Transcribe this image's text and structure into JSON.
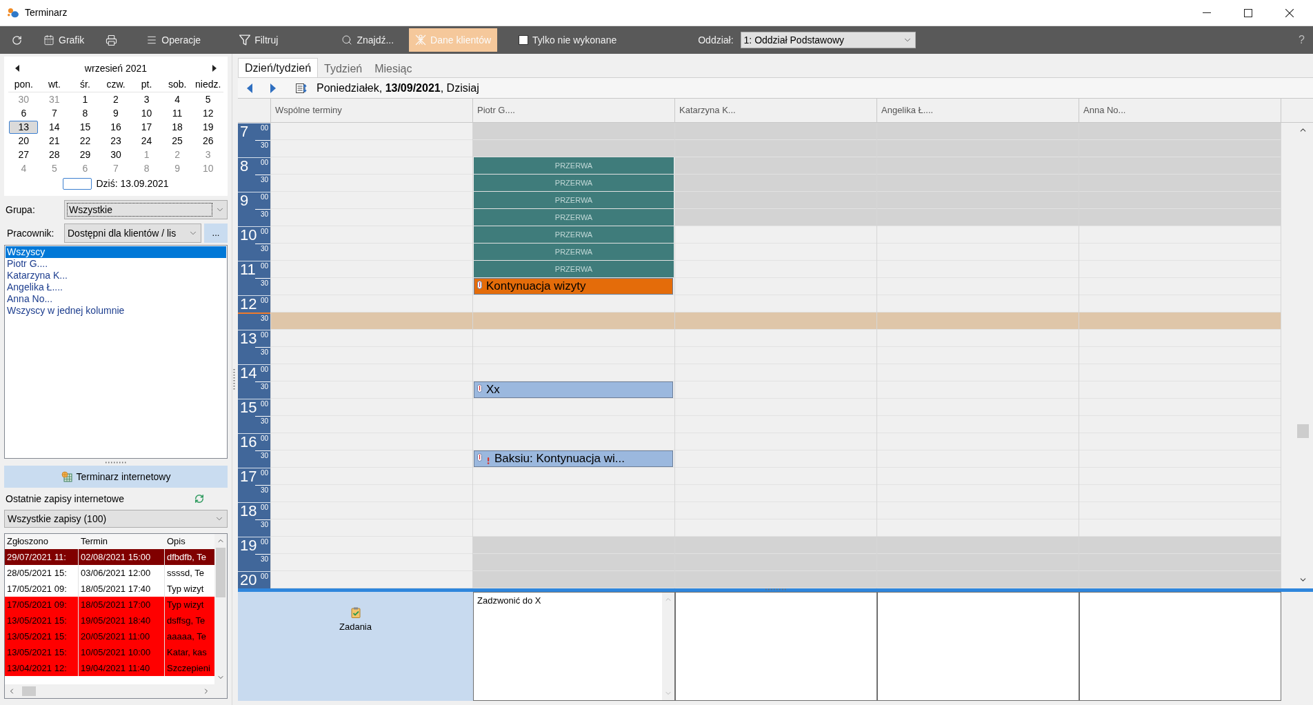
{
  "window": {
    "title": "Terminarz"
  },
  "toolbar": {
    "buttons": [
      {
        "label": "Grafik",
        "active": false
      },
      {
        "label": "Operacje",
        "active": false
      },
      {
        "label": "Filtruj",
        "active": false
      },
      {
        "label": "Znajdź...",
        "active": false
      },
      {
        "label": "Dane klientów",
        "active": true
      }
    ],
    "only_pending": {
      "label": "Tylko nie wykonane",
      "checked": false
    },
    "branch": {
      "label": "Oddział:",
      "value": "1: Oddział Podstawowy"
    },
    "help": "?"
  },
  "mini_calendar": {
    "month": "wrzesień 2021",
    "weekdays": [
      "pon.",
      "wt.",
      "śr.",
      "czw.",
      "pt.",
      "sob.",
      "niedz."
    ],
    "weeks": [
      [
        {
          "day": "30",
          "outside": true,
          "selected": false
        },
        {
          "day": "31",
          "outside": true,
          "selected": false
        },
        {
          "day": "1",
          "outside": false,
          "selected": false
        },
        {
          "day": "2",
          "outside": false,
          "selected": false
        },
        {
          "day": "3",
          "outside": false,
          "selected": false
        },
        {
          "day": "4",
          "outside": false,
          "selected": false
        },
        {
          "day": "5",
          "outside": false,
          "selected": false
        }
      ],
      [
        {
          "day": "6",
          "outside": false,
          "selected": false
        },
        {
          "day": "7",
          "outside": false,
          "selected": false
        },
        {
          "day": "8",
          "outside": false,
          "selected": false
        },
        {
          "day": "9",
          "outside": false,
          "selected": false
        },
        {
          "day": "10",
          "outside": false,
          "selected": false
        },
        {
          "day": "11",
          "outside": false,
          "selected": false
        },
        {
          "day": "12",
          "outside": false,
          "selected": false
        }
      ],
      [
        {
          "day": "13",
          "outside": false,
          "selected": true
        },
        {
          "day": "14",
          "outside": false,
          "selected": false
        },
        {
          "day": "15",
          "outside": false,
          "selected": false
        },
        {
          "day": "16",
          "outside": false,
          "selected": false
        },
        {
          "day": "17",
          "outside": false,
          "selected": false
        },
        {
          "day": "18",
          "outside": false,
          "selected": false
        },
        {
          "day": "19",
          "outside": false,
          "selected": false
        }
      ],
      [
        {
          "day": "20",
          "outside": false,
          "selected": false
        },
        {
          "day": "21",
          "outside": false,
          "selected": false
        },
        {
          "day": "22",
          "outside": false,
          "selected": false
        },
        {
          "day": "23",
          "outside": false,
          "selected": false
        },
        {
          "day": "24",
          "outside": false,
          "selected": false
        },
        {
          "day": "25",
          "outside": false,
          "selected": false
        },
        {
          "day": "26",
          "outside": false,
          "selected": false
        }
      ],
      [
        {
          "day": "27",
          "outside": false,
          "selected": false
        },
        {
          "day": "28",
          "outside": false,
          "selected": false
        },
        {
          "day": "29",
          "outside": false,
          "selected": false
        },
        {
          "day": "30",
          "outside": false,
          "selected": false
        },
        {
          "day": "1",
          "outside": true,
          "selected": false
        },
        {
          "day": "2",
          "outside": true,
          "selected": false
        },
        {
          "day": "3",
          "outside": true,
          "selected": false
        }
      ],
      [
        {
          "day": "4",
          "outside": true,
          "selected": false
        },
        {
          "day": "5",
          "outside": true,
          "selected": false
        },
        {
          "day": "6",
          "outside": true,
          "selected": false
        },
        {
          "day": "7",
          "outside": true,
          "selected": false
        },
        {
          "day": "8",
          "outside": true,
          "selected": false
        },
        {
          "day": "9",
          "outside": true,
          "selected": false
        },
        {
          "day": "10",
          "outside": true,
          "selected": false
        }
      ]
    ],
    "today": "Dziś: 13.09.2021"
  },
  "filters": {
    "group": {
      "label": "Grupa:",
      "value": "Wszystkie"
    },
    "employee": {
      "label": "Pracownik:",
      "value": "Dostępni dla klientów / lis",
      "more": "..."
    }
  },
  "employees": [
    {
      "name": "Wszyscy",
      "selected": true
    },
    {
      "name": "Piotr G....",
      "selected": false
    },
    {
      "name": "Katarzyna K...",
      "selected": false
    },
    {
      "name": "Angelika Ł....",
      "selected": false
    },
    {
      "name": "Anna No...",
      "selected": false
    },
    {
      "name": "Wszyscy w jednej kolumnie",
      "selected": false
    }
  ],
  "online": {
    "button": "Terminarz internetowy",
    "heading": "Ostatnie zapisy internetowe",
    "filter": "Wszystkie zapisy (100)",
    "columns": [
      "Zgłoszono",
      "Termin",
      "Opis"
    ],
    "rows": [
      {
        "cells": [
          "29/07/2021 11:",
          "02/08/2021 15:00",
          "dfbdfb, Te"
        ],
        "color": "#800000",
        "selected": true
      },
      {
        "cells": [
          "28/05/2021 15:",
          "03/06/2021 12:00",
          "ssssd, Te"
        ],
        "color": "#ffffff",
        "selected": false
      },
      {
        "cells": [
          "17/05/2021 09:",
          "18/05/2021 17:40",
          "Typ wizyt"
        ],
        "color": "#ffffff",
        "selected": false
      },
      {
        "cells": [
          "17/05/2021 09:",
          "18/05/2021 17:00",
          "Typ wizyt"
        ],
        "color": "#ff0000",
        "selected": false
      },
      {
        "cells": [
          "13/05/2021 15:",
          "19/05/2021 18:40",
          "dsffsg, Te"
        ],
        "color": "#ff0000",
        "selected": false
      },
      {
        "cells": [
          "13/05/2021 15:",
          "20/05/2021 11:00",
          "aaaaa, Te"
        ],
        "color": "#ff0000",
        "selected": false
      },
      {
        "cells": [
          "13/05/2021 15:",
          "10/05/2021 10:00",
          "Katar, kas"
        ],
        "color": "#ff0000",
        "selected": false
      },
      {
        "cells": [
          "13/04/2021 12:",
          "19/04/2021 11:40",
          "Szczepieni"
        ],
        "color": "#ff0000",
        "selected": false
      }
    ]
  },
  "calendar_view": {
    "tabs": [
      {
        "label": "Dzień/tydzień",
        "selected": true
      },
      {
        "label": "Tydzień",
        "selected": false
      },
      {
        "label": "Miesiąc",
        "selected": false
      }
    ],
    "date": "Poniedziałek, **13/09/2021**, Dzisiaj",
    "rows": [
      {
        "hour": "7",
        "minute": "00",
        "now": false
      },
      {
        "minute": "30",
        "now": false
      },
      {
        "hour": "8",
        "minute": "00",
        "now": false
      },
      {
        "minute": "30",
        "now": false
      },
      {
        "hour": "9",
        "minute": "00",
        "now": false
      },
      {
        "minute": "30",
        "now": false
      },
      {
        "hour": "10",
        "minute": "00",
        "now": false
      },
      {
        "minute": "30",
        "now": false
      },
      {
        "hour": "11",
        "minute": "00",
        "now": false
      },
      {
        "minute": "30",
        "now": false
      },
      {
        "hour": "12",
        "minute": "00",
        "now": false
      },
      {
        "minute": "30",
        "now": true
      },
      {
        "hour": "13",
        "minute": "00",
        "now": false
      },
      {
        "minute": "30",
        "now": false
      },
      {
        "hour": "14",
        "minute": "00",
        "now": false
      },
      {
        "minute": "30",
        "now": false
      },
      {
        "hour": "15",
        "minute": "00",
        "now": false
      },
      {
        "minute": "30",
        "now": false
      },
      {
        "hour": "16",
        "minute": "00",
        "now": false
      },
      {
        "minute": "30",
        "now": false
      },
      {
        "hour": "17",
        "minute": "00",
        "now": false
      },
      {
        "minute": "30",
        "now": false
      },
      {
        "hour": "18",
        "minute": "00",
        "now": false
      },
      {
        "minute": "30",
        "now": false
      },
      {
        "hour": "19",
        "minute": "00",
        "now": false
      },
      {
        "minute": "30",
        "now": false
      },
      {
        "hour": "20",
        "minute": "00",
        "now": false
      }
    ],
    "columns": [
      {
        "name": "Wspólne terminy",
        "cells": [
          {
            "kind": "free"
          },
          {
            "kind": "free"
          },
          {
            "kind": "free"
          },
          {
            "kind": "free"
          },
          {
            "kind": "free"
          },
          {
            "kind": "free"
          },
          {
            "kind": "free"
          },
          {
            "kind": "free"
          },
          {
            "kind": "free"
          },
          {
            "kind": "free"
          },
          {
            "kind": "free"
          },
          {
            "kind": "free"
          },
          {
            "kind": "free"
          },
          {
            "kind": "free"
          },
          {
            "kind": "free"
          },
          {
            "kind": "free"
          },
          {
            "kind": "free"
          },
          {
            "kind": "free"
          },
          {
            "kind": "free"
          },
          {
            "kind": "free"
          },
          {
            "kind": "free"
          },
          {
            "kind": "free"
          },
          {
            "kind": "free"
          },
          {
            "kind": "free"
          },
          {
            "kind": "free"
          },
          {
            "kind": "free"
          },
          {
            "kind": "free"
          }
        ]
      },
      {
        "name": "Piotr G....",
        "cells": [
          {
            "kind": "off"
          },
          {
            "kind": "off"
          },
          {
            "kind": "break",
            "title": "PRZERWA"
          },
          {
            "kind": "break",
            "title": "PRZERWA"
          },
          {
            "kind": "break",
            "title": "PRZERWA"
          },
          {
            "kind": "break",
            "title": "PRZERWA"
          },
          {
            "kind": "break",
            "title": "PRZERWA"
          },
          {
            "kind": "break",
            "title": "PRZERWA"
          },
          {
            "kind": "break",
            "title": "PRZERWA"
          },
          {
            "kind": "visit",
            "title": "Kontynuacja wizyty",
            "color": "#e46c0a",
            "alert": false
          },
          {
            "kind": "free"
          },
          {
            "kind": "free"
          },
          {
            "kind": "free"
          },
          {
            "kind": "free"
          },
          {
            "kind": "free"
          },
          {
            "kind": "visit",
            "title": "Xx",
            "color": "#9bb8de",
            "alert": false
          },
          {
            "kind": "free"
          },
          {
            "kind": "free"
          },
          {
            "kind": "free"
          },
          {
            "kind": "visit",
            "title": "Baksiu: Kontynuacja wi...",
            "color": "#9bb8de",
            "alert": true
          },
          {
            "kind": "free"
          },
          {
            "kind": "free"
          },
          {
            "kind": "free"
          },
          {
            "kind": "free"
          },
          {
            "kind": "off"
          },
          {
            "kind": "off"
          },
          {
            "kind": "off"
          }
        ],
        "tasks": [
          "Zadzwonić do X"
        ]
      },
      {
        "name": "Katarzyna K...",
        "cells": [
          {
            "kind": "off"
          },
          {
            "kind": "off"
          },
          {
            "kind": "off"
          },
          {
            "kind": "off"
          },
          {
            "kind": "off"
          },
          {
            "kind": "off"
          },
          {
            "kind": "free"
          },
          {
            "kind": "free"
          },
          {
            "kind": "free"
          },
          {
            "kind": "free"
          },
          {
            "kind": "free"
          },
          {
            "kind": "free"
          },
          {
            "kind": "free"
          },
          {
            "kind": "free"
          },
          {
            "kind": "free"
          },
          {
            "kind": "free"
          },
          {
            "kind": "free"
          },
          {
            "kind": "free"
          },
          {
            "kind": "free"
          },
          {
            "kind": "free"
          },
          {
            "kind": "free"
          },
          {
            "kind": "free"
          },
          {
            "kind": "free"
          },
          {
            "kind": "free"
          },
          {
            "kind": "off"
          },
          {
            "kind": "off"
          },
          {
            "kind": "off"
          }
        ]
      },
      {
        "name": "Angelika Ł....",
        "cells": [
          {
            "kind": "off"
          },
          {
            "kind": "off"
          },
          {
            "kind": "off"
          },
          {
            "kind": "off"
          },
          {
            "kind": "off"
          },
          {
            "kind": "off"
          },
          {
            "kind": "free"
          },
          {
            "kind": "free"
          },
          {
            "kind": "free"
          },
          {
            "kind": "free"
          },
          {
            "kind": "free"
          },
          {
            "kind": "free"
          },
          {
            "kind": "free"
          },
          {
            "kind": "free"
          },
          {
            "kind": "free"
          },
          {
            "kind": "free"
          },
          {
            "kind": "free"
          },
          {
            "kind": "free"
          },
          {
            "kind": "free"
          },
          {
            "kind": "free"
          },
          {
            "kind": "free"
          },
          {
            "kind": "free"
          },
          {
            "kind": "free"
          },
          {
            "kind": "free"
          },
          {
            "kind": "off"
          },
          {
            "kind": "off"
          },
          {
            "kind": "off"
          }
        ]
      },
      {
        "name": "Anna No...",
        "cells": [
          {
            "kind": "off"
          },
          {
            "kind": "off"
          },
          {
            "kind": "off"
          },
          {
            "kind": "off"
          },
          {
            "kind": "off"
          },
          {
            "kind": "off"
          },
          {
            "kind": "free"
          },
          {
            "kind": "free"
          },
          {
            "kind": "free"
          },
          {
            "kind": "free"
          },
          {
            "kind": "free"
          },
          {
            "kind": "free"
          },
          {
            "kind": "free"
          },
          {
            "kind": "free"
          },
          {
            "kind": "free"
          },
          {
            "kind": "free"
          },
          {
            "kind": "free"
          },
          {
            "kind": "free"
          },
          {
            "kind": "free"
          },
          {
            "kind": "free"
          },
          {
            "kind": "free"
          },
          {
            "kind": "free"
          },
          {
            "kind": "free"
          },
          {
            "kind": "free"
          },
          {
            "kind": "off"
          },
          {
            "kind": "off"
          },
          {
            "kind": "off"
          }
        ]
      }
    ],
    "tasks_label": "Zadania"
  }
}
